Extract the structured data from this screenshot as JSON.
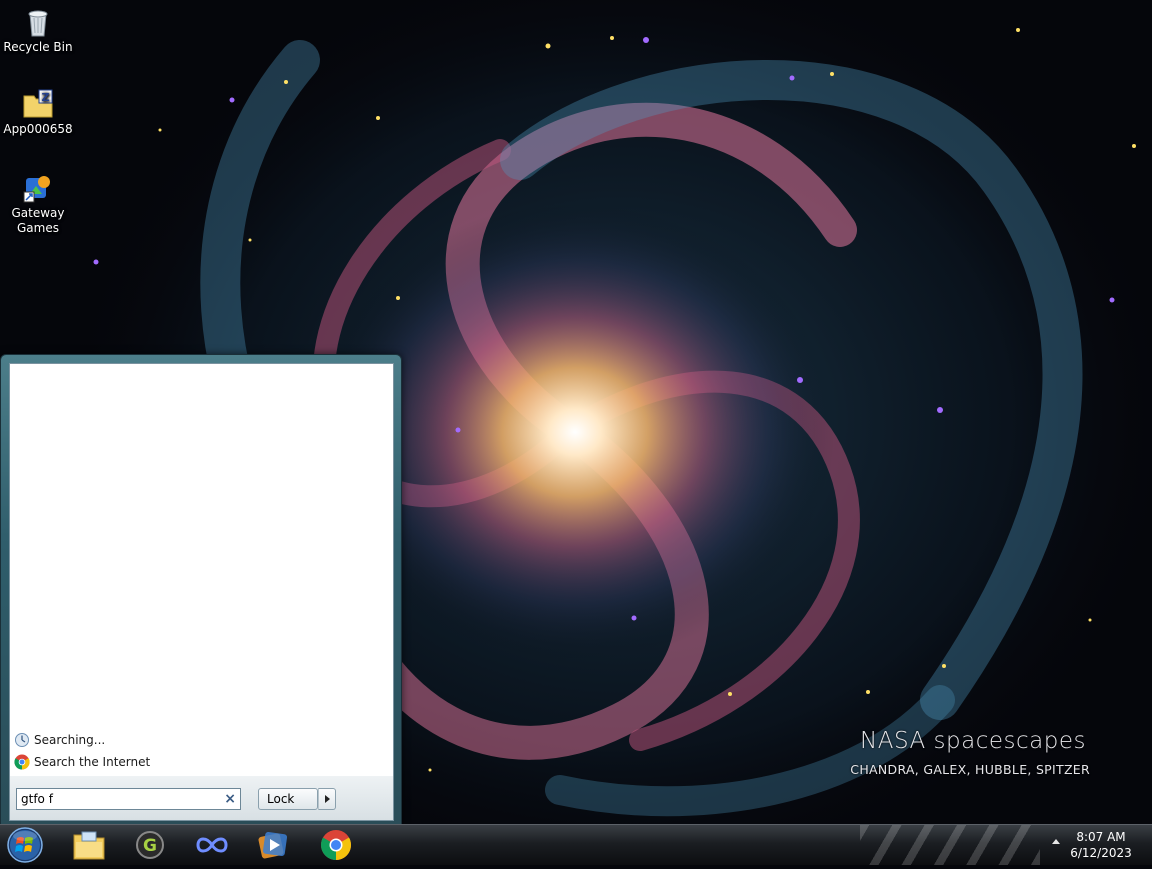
{
  "desktop": {
    "icons": [
      {
        "label": "Recycle Bin"
      },
      {
        "label": "App000658"
      },
      {
        "label": "Gateway Games"
      }
    ],
    "wallpaper": {
      "title": "NASA spacescapes",
      "subtitle": "CHANDRA, GALEX, HUBBLE, SPITZER"
    }
  },
  "start_menu": {
    "results": [
      {
        "label": "Searching...",
        "icon": "searching-icon"
      },
      {
        "label": "Search the Internet",
        "icon": "chrome-icon"
      }
    ],
    "search": {
      "value": "gtfo f",
      "clear_icon": "close-icon"
    },
    "lock_button": {
      "label": "Lock",
      "arrow_icon": "chevron-right-icon"
    }
  },
  "taskbar": {
    "start_button": "windows-start-icon",
    "pinned": [
      {
        "icon": "file-explorer-icon"
      },
      {
        "icon": "g-app-icon"
      },
      {
        "icon": "infinity-app-icon"
      },
      {
        "icon": "media-player-icon"
      },
      {
        "icon": "chrome-icon"
      }
    ],
    "clock": {
      "time": "8:07 AM",
      "date": "6/12/2023"
    }
  },
  "colors": {
    "taskbar": "#1b1e22",
    "start_menu_frame": "#2f5d6b",
    "accent_blue": "#3a5b84"
  }
}
